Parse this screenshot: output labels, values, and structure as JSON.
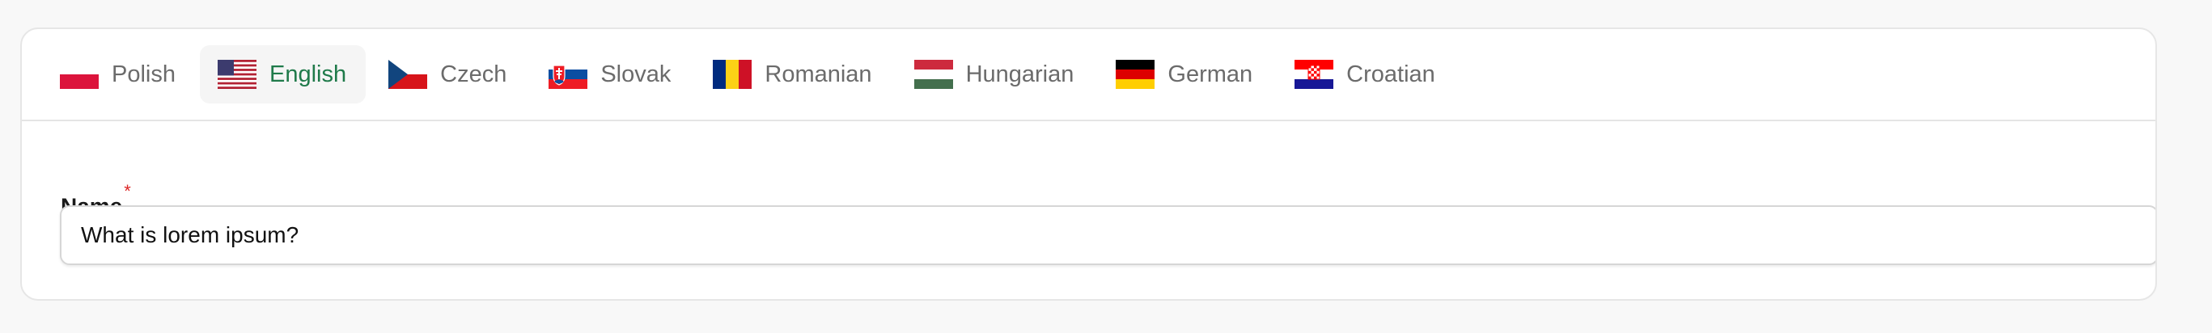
{
  "tabs": [
    {
      "label": "Polish",
      "flag": "flag-pl",
      "active": false
    },
    {
      "label": "English",
      "flag": "flag-us",
      "active": true
    },
    {
      "label": "Czech",
      "flag": "flag-cz",
      "active": false
    },
    {
      "label": "Slovak",
      "flag": "flag-sk",
      "active": false
    },
    {
      "label": "Romanian",
      "flag": "flag-ro",
      "active": false
    },
    {
      "label": "Hungarian",
      "flag": "flag-hu",
      "active": false
    },
    {
      "label": "German",
      "flag": "flag-de",
      "active": false
    },
    {
      "label": "Croatian",
      "flag": "flag-hr",
      "active": false
    }
  ],
  "form": {
    "name_label": "Name",
    "required_marker": "*",
    "name_value": "What is lorem ipsum?"
  },
  "colors": {
    "active_tab_text": "#1f7a4a",
    "inactive_tab_text": "#6b6b6b",
    "required": "#dc2626"
  }
}
